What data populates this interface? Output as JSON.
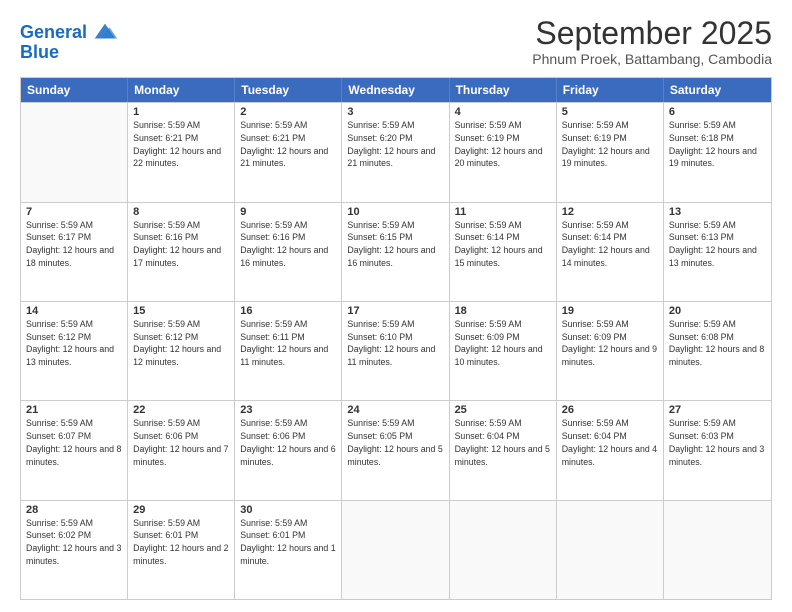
{
  "header": {
    "logo_line1": "General",
    "logo_line2": "Blue",
    "month": "September 2025",
    "location": "Phnum Proek, Battambang, Cambodia"
  },
  "days_of_week": [
    "Sunday",
    "Monday",
    "Tuesday",
    "Wednesday",
    "Thursday",
    "Friday",
    "Saturday"
  ],
  "weeks": [
    [
      {
        "day": "",
        "empty": true
      },
      {
        "day": "1",
        "sunrise": "5:59 AM",
        "sunset": "6:21 PM",
        "daylight": "12 hours and 22 minutes."
      },
      {
        "day": "2",
        "sunrise": "5:59 AM",
        "sunset": "6:21 PM",
        "daylight": "12 hours and 21 minutes."
      },
      {
        "day": "3",
        "sunrise": "5:59 AM",
        "sunset": "6:20 PM",
        "daylight": "12 hours and 21 minutes."
      },
      {
        "day": "4",
        "sunrise": "5:59 AM",
        "sunset": "6:19 PM",
        "daylight": "12 hours and 20 minutes."
      },
      {
        "day": "5",
        "sunrise": "5:59 AM",
        "sunset": "6:19 PM",
        "daylight": "12 hours and 19 minutes."
      },
      {
        "day": "6",
        "sunrise": "5:59 AM",
        "sunset": "6:18 PM",
        "daylight": "12 hours and 19 minutes."
      }
    ],
    [
      {
        "day": "7",
        "sunrise": "5:59 AM",
        "sunset": "6:17 PM",
        "daylight": "12 hours and 18 minutes."
      },
      {
        "day": "8",
        "sunrise": "5:59 AM",
        "sunset": "6:16 PM",
        "daylight": "12 hours and 17 minutes."
      },
      {
        "day": "9",
        "sunrise": "5:59 AM",
        "sunset": "6:16 PM",
        "daylight": "12 hours and 16 minutes."
      },
      {
        "day": "10",
        "sunrise": "5:59 AM",
        "sunset": "6:15 PM",
        "daylight": "12 hours and 16 minutes."
      },
      {
        "day": "11",
        "sunrise": "5:59 AM",
        "sunset": "6:14 PM",
        "daylight": "12 hours and 15 minutes."
      },
      {
        "day": "12",
        "sunrise": "5:59 AM",
        "sunset": "6:14 PM",
        "daylight": "12 hours and 14 minutes."
      },
      {
        "day": "13",
        "sunrise": "5:59 AM",
        "sunset": "6:13 PM",
        "daylight": "12 hours and 13 minutes."
      }
    ],
    [
      {
        "day": "14",
        "sunrise": "5:59 AM",
        "sunset": "6:12 PM",
        "daylight": "12 hours and 13 minutes."
      },
      {
        "day": "15",
        "sunrise": "5:59 AM",
        "sunset": "6:12 PM",
        "daylight": "12 hours and 12 minutes."
      },
      {
        "day": "16",
        "sunrise": "5:59 AM",
        "sunset": "6:11 PM",
        "daylight": "12 hours and 11 minutes."
      },
      {
        "day": "17",
        "sunrise": "5:59 AM",
        "sunset": "6:10 PM",
        "daylight": "12 hours and 11 minutes."
      },
      {
        "day": "18",
        "sunrise": "5:59 AM",
        "sunset": "6:09 PM",
        "daylight": "12 hours and 10 minutes."
      },
      {
        "day": "19",
        "sunrise": "5:59 AM",
        "sunset": "6:09 PM",
        "daylight": "12 hours and 9 minutes."
      },
      {
        "day": "20",
        "sunrise": "5:59 AM",
        "sunset": "6:08 PM",
        "daylight": "12 hours and 8 minutes."
      }
    ],
    [
      {
        "day": "21",
        "sunrise": "5:59 AM",
        "sunset": "6:07 PM",
        "daylight": "12 hours and 8 minutes."
      },
      {
        "day": "22",
        "sunrise": "5:59 AM",
        "sunset": "6:06 PM",
        "daylight": "12 hours and 7 minutes."
      },
      {
        "day": "23",
        "sunrise": "5:59 AM",
        "sunset": "6:06 PM",
        "daylight": "12 hours and 6 minutes."
      },
      {
        "day": "24",
        "sunrise": "5:59 AM",
        "sunset": "6:05 PM",
        "daylight": "12 hours and 5 minutes."
      },
      {
        "day": "25",
        "sunrise": "5:59 AM",
        "sunset": "6:04 PM",
        "daylight": "12 hours and 5 minutes."
      },
      {
        "day": "26",
        "sunrise": "5:59 AM",
        "sunset": "6:04 PM",
        "daylight": "12 hours and 4 minutes."
      },
      {
        "day": "27",
        "sunrise": "5:59 AM",
        "sunset": "6:03 PM",
        "daylight": "12 hours and 3 minutes."
      }
    ],
    [
      {
        "day": "28",
        "sunrise": "5:59 AM",
        "sunset": "6:02 PM",
        "daylight": "12 hours and 3 minutes."
      },
      {
        "day": "29",
        "sunrise": "5:59 AM",
        "sunset": "6:01 PM",
        "daylight": "12 hours and 2 minutes."
      },
      {
        "day": "30",
        "sunrise": "5:59 AM",
        "sunset": "6:01 PM",
        "daylight": "12 hours and 1 minute."
      },
      {
        "day": "",
        "empty": true
      },
      {
        "day": "",
        "empty": true
      },
      {
        "day": "",
        "empty": true
      },
      {
        "day": "",
        "empty": true
      }
    ]
  ]
}
